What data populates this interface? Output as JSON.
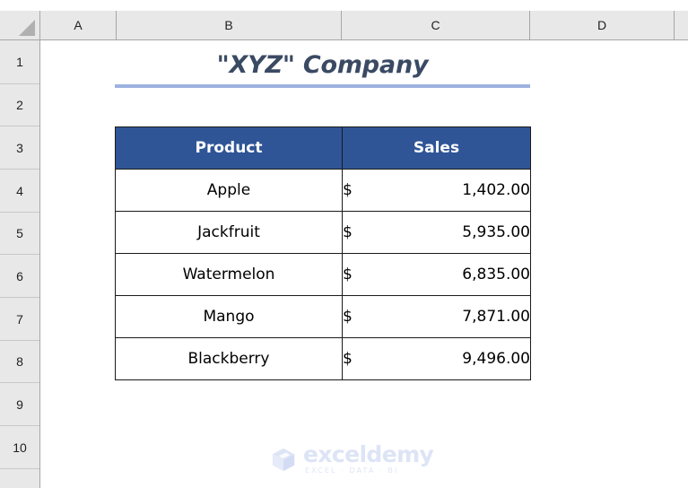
{
  "app": {
    "type": "spreadsheet",
    "select_all_label": "Select All"
  },
  "columns": [
    {
      "label": "A"
    },
    {
      "label": "B"
    },
    {
      "label": "C"
    },
    {
      "label": "D"
    }
  ],
  "rows": [
    {
      "label": "1"
    },
    {
      "label": "2"
    },
    {
      "label": "3"
    },
    {
      "label": "4"
    },
    {
      "label": "5"
    },
    {
      "label": "6"
    },
    {
      "label": "7"
    },
    {
      "label": "8"
    },
    {
      "label": "9"
    },
    {
      "label": "10"
    }
  ],
  "title": {
    "text": "\"XYZ\" Company",
    "color": "#3b4a63",
    "rule_color": "#9db2e0"
  },
  "table": {
    "header_bg": "#2f5597",
    "header_color": "#ffffff",
    "border_color": "#1a1a1a",
    "headers": [
      {
        "label": "Product"
      },
      {
        "label": "Sales"
      }
    ],
    "rows": [
      {
        "product": "Apple",
        "currency": "$",
        "amount": "1,402.00"
      },
      {
        "product": "Jackfruit",
        "currency": "$",
        "amount": "5,935.00"
      },
      {
        "product": "Watermelon",
        "currency": "$",
        "amount": "6,835.00"
      },
      {
        "product": "Mango",
        "currency": "$",
        "amount": "7,871.00"
      },
      {
        "product": "Blackberry",
        "currency": "$",
        "amount": "9,496.00"
      }
    ]
  },
  "watermark": {
    "word": "exceldemy",
    "tagline": "EXCEL · DATA · BI",
    "color": "#dde4f6"
  }
}
